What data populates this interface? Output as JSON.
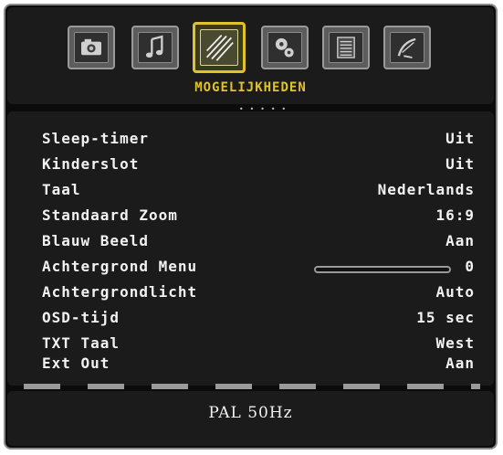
{
  "menu": {
    "title": "MOGELIJKHEDEN",
    "tabs": [
      {
        "icon": "camera-icon",
        "active": false
      },
      {
        "icon": "music-note-icon",
        "active": false
      },
      {
        "icon": "features-icon",
        "active": true
      },
      {
        "icon": "gears-icon",
        "active": false
      },
      {
        "icon": "list-icon",
        "active": false
      },
      {
        "icon": "satellite-dish-icon",
        "active": false
      }
    ],
    "accent_color": "#e0c22a"
  },
  "settings": [
    {
      "label": "Sleep-timer",
      "value": "Uit"
    },
    {
      "label": "Kinderslot",
      "value": "Uit"
    },
    {
      "label": "Taal",
      "value": "Nederlands"
    },
    {
      "label": "Standaard Zoom",
      "value": "16:9"
    },
    {
      "label": "Blauw Beeld",
      "value": "Aan"
    },
    {
      "label": "Achtergrond Menu",
      "value": "0",
      "slider_level": 0
    },
    {
      "label": "Achtergrondlicht",
      "value": "Auto"
    },
    {
      "label": "OSD-tijd",
      "value": "15 sec"
    },
    {
      "label": "TXT Taal",
      "value": "West"
    },
    {
      "label": "Ext Out",
      "value": "Aan"
    }
  ],
  "status": {
    "signal": "PAL 50Hz"
  }
}
